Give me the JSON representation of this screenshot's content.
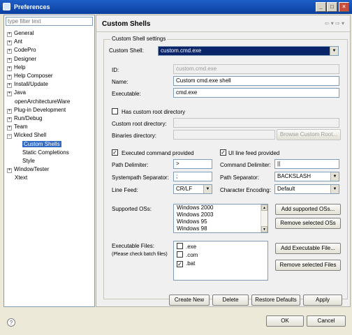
{
  "window": {
    "title": "Preferences"
  },
  "filter": {
    "placeholder": "type filter text"
  },
  "tree": [
    {
      "label": "General",
      "expandable": true,
      "level": 0
    },
    {
      "label": "Ant",
      "expandable": true,
      "level": 0
    },
    {
      "label": "CodePro",
      "expandable": true,
      "level": 0
    },
    {
      "label": "Designer",
      "expandable": true,
      "level": 0
    },
    {
      "label": "Help",
      "expandable": true,
      "level": 0
    },
    {
      "label": "Help Composer",
      "expandable": true,
      "level": 0
    },
    {
      "label": "Install/Update",
      "expandable": true,
      "level": 0
    },
    {
      "label": "Java",
      "expandable": true,
      "level": 0
    },
    {
      "label": "openArchitectureWare",
      "expandable": false,
      "level": 0
    },
    {
      "label": "Plug-in Development",
      "expandable": true,
      "level": 0
    },
    {
      "label": "Run/Debug",
      "expandable": true,
      "level": 0
    },
    {
      "label": "Team",
      "expandable": true,
      "level": 0
    },
    {
      "label": "Wicked Shell",
      "expandable": true,
      "expanded": true,
      "level": 0
    },
    {
      "label": "Custom Shells",
      "expandable": false,
      "level": 1,
      "selected": true
    },
    {
      "label": "Static Completions",
      "expandable": false,
      "level": 1
    },
    {
      "label": "Style",
      "expandable": false,
      "level": 1
    },
    {
      "label": "WindowTester",
      "expandable": true,
      "level": 0
    },
    {
      "label": "Xtext",
      "expandable": false,
      "level": 0
    }
  ],
  "page": {
    "title": "Custom Shells",
    "group_title": "Custom Shell settings"
  },
  "custom_shell": {
    "label": "Custom Shell:",
    "value": "custom.cmd.exe"
  },
  "id": {
    "label": "ID:",
    "value": "custom.cmd.exe"
  },
  "name": {
    "label": "Name:",
    "value": "Custom cmd.exe shell"
  },
  "executable": {
    "label": "Executable:",
    "value": "cmd.exe"
  },
  "has_root": {
    "label": "Has custom root directory",
    "checked": false
  },
  "root_dir": {
    "label": "Custom root directory:",
    "value": ""
  },
  "binaries_dir": {
    "label": "Binaries directory:",
    "value": ""
  },
  "browse_root": {
    "label": "Browse Custom Root..."
  },
  "exec_provided": {
    "label": "Executed command provided",
    "checked": true
  },
  "ui_linefeed": {
    "label": "UI line feed provided",
    "checked": true
  },
  "path_delim": {
    "label": "Path Delimiter:",
    "value": ">"
  },
  "cmd_delim": {
    "label": "Command Delimiter:",
    "value": "||"
  },
  "syspath_sep": {
    "label": "Systempath Separator:",
    "value": ";"
  },
  "path_sep": {
    "label": "Path Separator:",
    "value": "BACKSLASH"
  },
  "line_feed": {
    "label": "Line Feed:",
    "value": "CR/LF"
  },
  "char_enc": {
    "label": "Character Encoding:",
    "value": "Default"
  },
  "supported_os": {
    "label": "Supported OSs:",
    "items": [
      "Windows 2000",
      "Windows 2003",
      "Windows 95",
      "Windows 98"
    ]
  },
  "add_os": {
    "label": "Add supported OSs..."
  },
  "remove_os": {
    "label": "Remove selected OSs"
  },
  "exec_files": {
    "label": "Executable Files:",
    "note": "(Please check batch files)",
    "items": [
      {
        "name": ".exe",
        "checked": false
      },
      {
        "name": ".com",
        "checked": false
      },
      {
        "name": ".bat",
        "checked": true
      }
    ]
  },
  "add_exec": {
    "label": "Add Executable File..."
  },
  "remove_files": {
    "label": "Remove selected Files"
  },
  "actions": {
    "create_new": "Create New",
    "delete": "Delete",
    "restore": "Restore Defaults",
    "apply": "Apply"
  },
  "dialog": {
    "ok": "OK",
    "cancel": "Cancel"
  },
  "icons": {
    "help": "help-icon",
    "back": "back-arrow-icon",
    "forward": "forward-arrow-icon"
  }
}
